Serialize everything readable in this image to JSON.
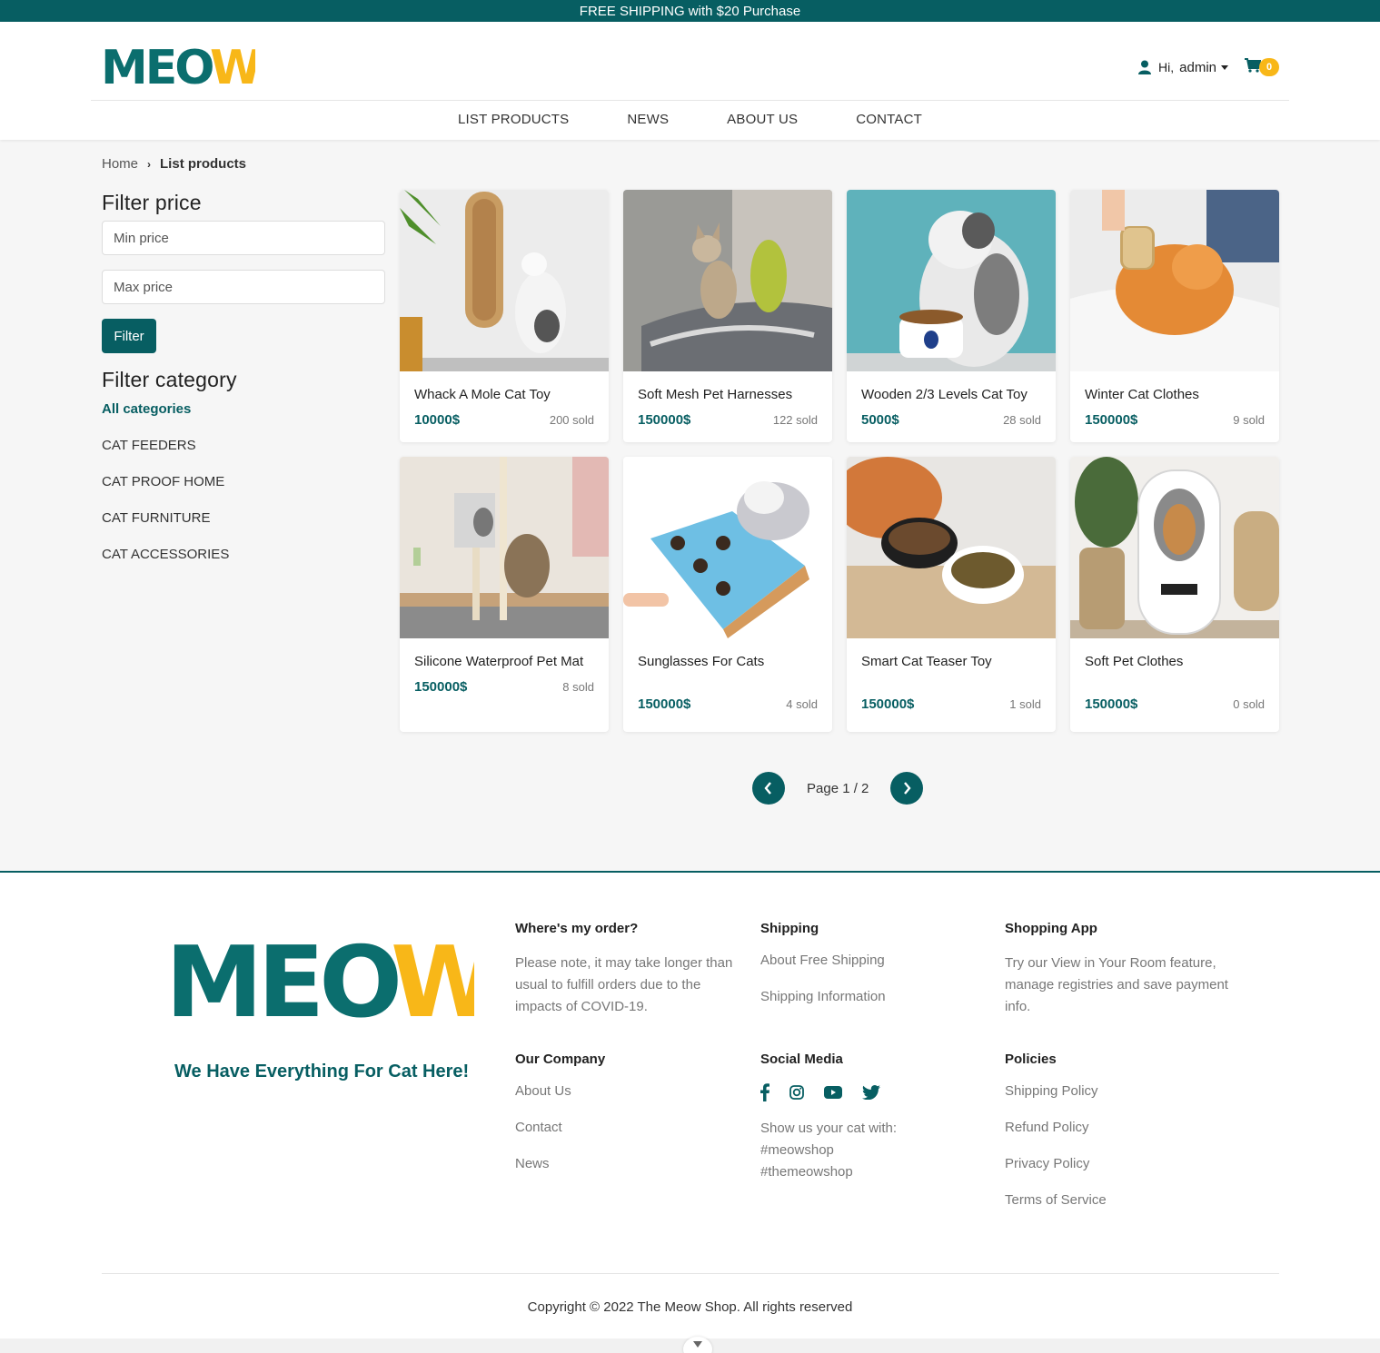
{
  "topbar": {
    "text": "FREE SHIPPING with $20 Purchase"
  },
  "header": {
    "logo_text": "MEOW",
    "greeting": "Hi,",
    "username": "admin",
    "cart_count": "0",
    "nav": [
      {
        "label": "LIST PRODUCTS"
      },
      {
        "label": "NEWS"
      },
      {
        "label": "ABOUT US"
      },
      {
        "label": "CONTACT"
      }
    ]
  },
  "breadcrumb": {
    "home": "Home",
    "current": "List products"
  },
  "sidebar": {
    "filter_price_title": "Filter price",
    "min_placeholder": "Min price",
    "max_placeholder": "Max price",
    "filter_button": "Filter",
    "filter_category_title": "Filter category",
    "categories": [
      {
        "label": "All categories"
      },
      {
        "label": "CAT FEEDERS"
      },
      {
        "label": "CAT PROOF HOME"
      },
      {
        "label": "CAT FURNITURE"
      },
      {
        "label": "CAT ACCESSORIES"
      }
    ]
  },
  "products": [
    {
      "name": "Whack A Mole Cat Toy",
      "price": "10000$",
      "sold": "200 sold"
    },
    {
      "name": "Soft Mesh Pet Harnesses",
      "price": "150000$",
      "sold": "122 sold"
    },
    {
      "name": "Wooden 2/3 Levels Cat Toy",
      "price": "5000$",
      "sold": "28 sold"
    },
    {
      "name": "Winter Cat Clothes",
      "price": "150000$",
      "sold": "9 sold"
    },
    {
      "name": "Silicone Waterproof Pet Mat",
      "price": "150000$",
      "sold": "8 sold"
    },
    {
      "name": "Sunglasses For Cats",
      "price": "150000$",
      "sold": "4 sold"
    },
    {
      "name": "Smart Cat Teaser Toy",
      "price": "150000$",
      "sold": "1 sold"
    },
    {
      "name": "Soft Pet Clothes",
      "price": "150000$",
      "sold": "0 sold"
    }
  ],
  "pagination": {
    "text": "Page 1 / 2"
  },
  "footer": {
    "logo_text": "MEOW",
    "tagline": "We Have Everything For Cat Here!",
    "where_title": "Where's my order?",
    "where_text": "Please note, it may take longer than usual to fulfill orders due to the impacts of COVID-19.",
    "shipping_title": "Shipping",
    "shipping_links": [
      {
        "label": "About Free Shipping"
      },
      {
        "label": "Shipping Information"
      }
    ],
    "app_title": "Shopping App",
    "app_text": "Try our View in Your Room feature, manage registries and save payment info.",
    "company_title": "Our Company",
    "company_links": [
      {
        "label": "About Us"
      },
      {
        "label": "Contact"
      },
      {
        "label": "News"
      }
    ],
    "social_title": "Social Media",
    "social_icons": [
      "facebook-icon",
      "instagram-icon",
      "youtube-icon",
      "twitter-icon"
    ],
    "social_text_1": "Show us your cat with:",
    "social_text_2": "#meowshop",
    "social_text_3": "#themeowshop",
    "policies_title": "Policies",
    "policies_links": [
      {
        "label": "Shipping Policy"
      },
      {
        "label": "Refund Policy"
      },
      {
        "label": "Privacy Policy"
      },
      {
        "label": "Terms of Service"
      }
    ],
    "copyright": "Copyright © 2022 The Meow Shop. All rights reserved"
  },
  "colors": {
    "brand": "#075e62",
    "accent": "#f8b718"
  }
}
